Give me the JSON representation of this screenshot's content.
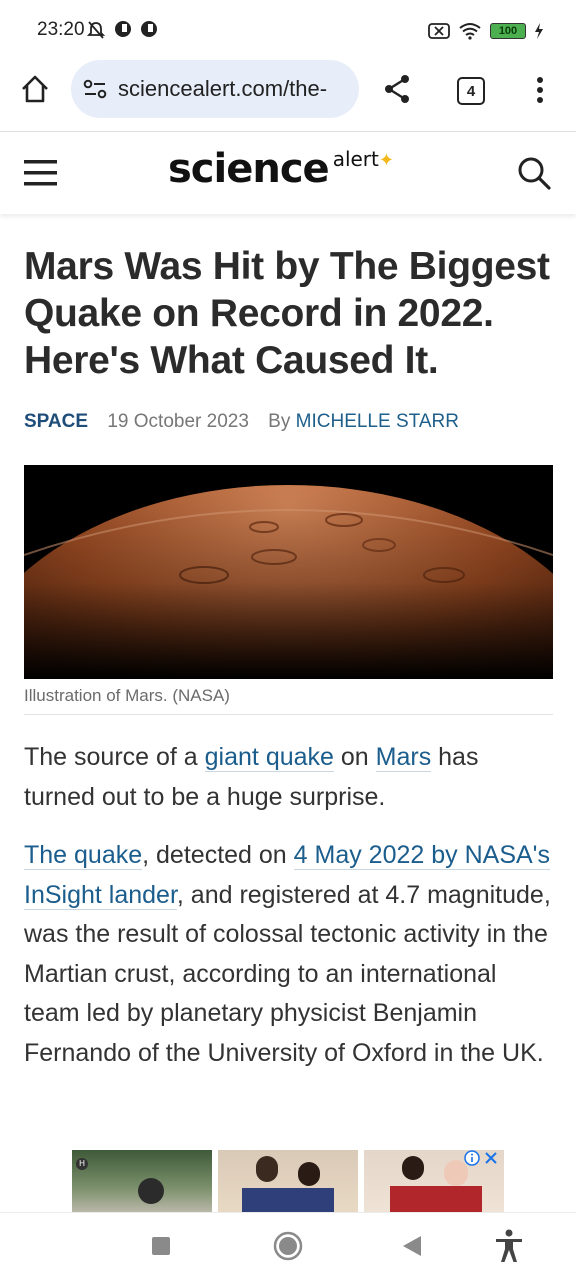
{
  "status_bar": {
    "time": "23:20",
    "battery": "100"
  },
  "browser": {
    "url": "sciencealert.com/the-",
    "tab_count": "4"
  },
  "site": {
    "logo_main": "science",
    "logo_sub": "alert"
  },
  "article": {
    "title": "Mars Was Hit by The Biggest Quake on Record in 2022. Here's What Caused It.",
    "category": "SPACE",
    "date": "19 October 2023",
    "by": "By",
    "author": "MICHELLE STARR",
    "caption": "Illustration of Mars. (NASA)",
    "p1": {
      "t1": "The source of a ",
      "link1": "giant quake",
      "t2": " on ",
      "link2": "Mars",
      "t3": " has turned out to be a huge surprise."
    },
    "p2": {
      "link1": "The quake",
      "t1": ", detected on ",
      "link2": "4 May 2022 by NASA's InSight lander",
      "t2": ", and registered at 4.7 magnitude, was the result of colossal tectonic activity in the Martian crust, according to an international team led by planetary physicist Benjamin Fernando of the University of Oxford in the UK."
    }
  },
  "ad": {
    "badge": "H"
  },
  "colors": {
    "link": "#1b5d8c",
    "category": "#1f4d7a",
    "url_bar": "#e8eef9",
    "accent_spark": "#f3b91a",
    "ad_info": "#1a73e8"
  },
  "icons": [
    "home-icon",
    "site-settings-icon",
    "share-icon",
    "more-icon",
    "menu-icon",
    "search-icon",
    "info-icon",
    "close-icon",
    "stop-icon",
    "home-circle-icon",
    "back-icon",
    "accessibility-icon"
  ]
}
